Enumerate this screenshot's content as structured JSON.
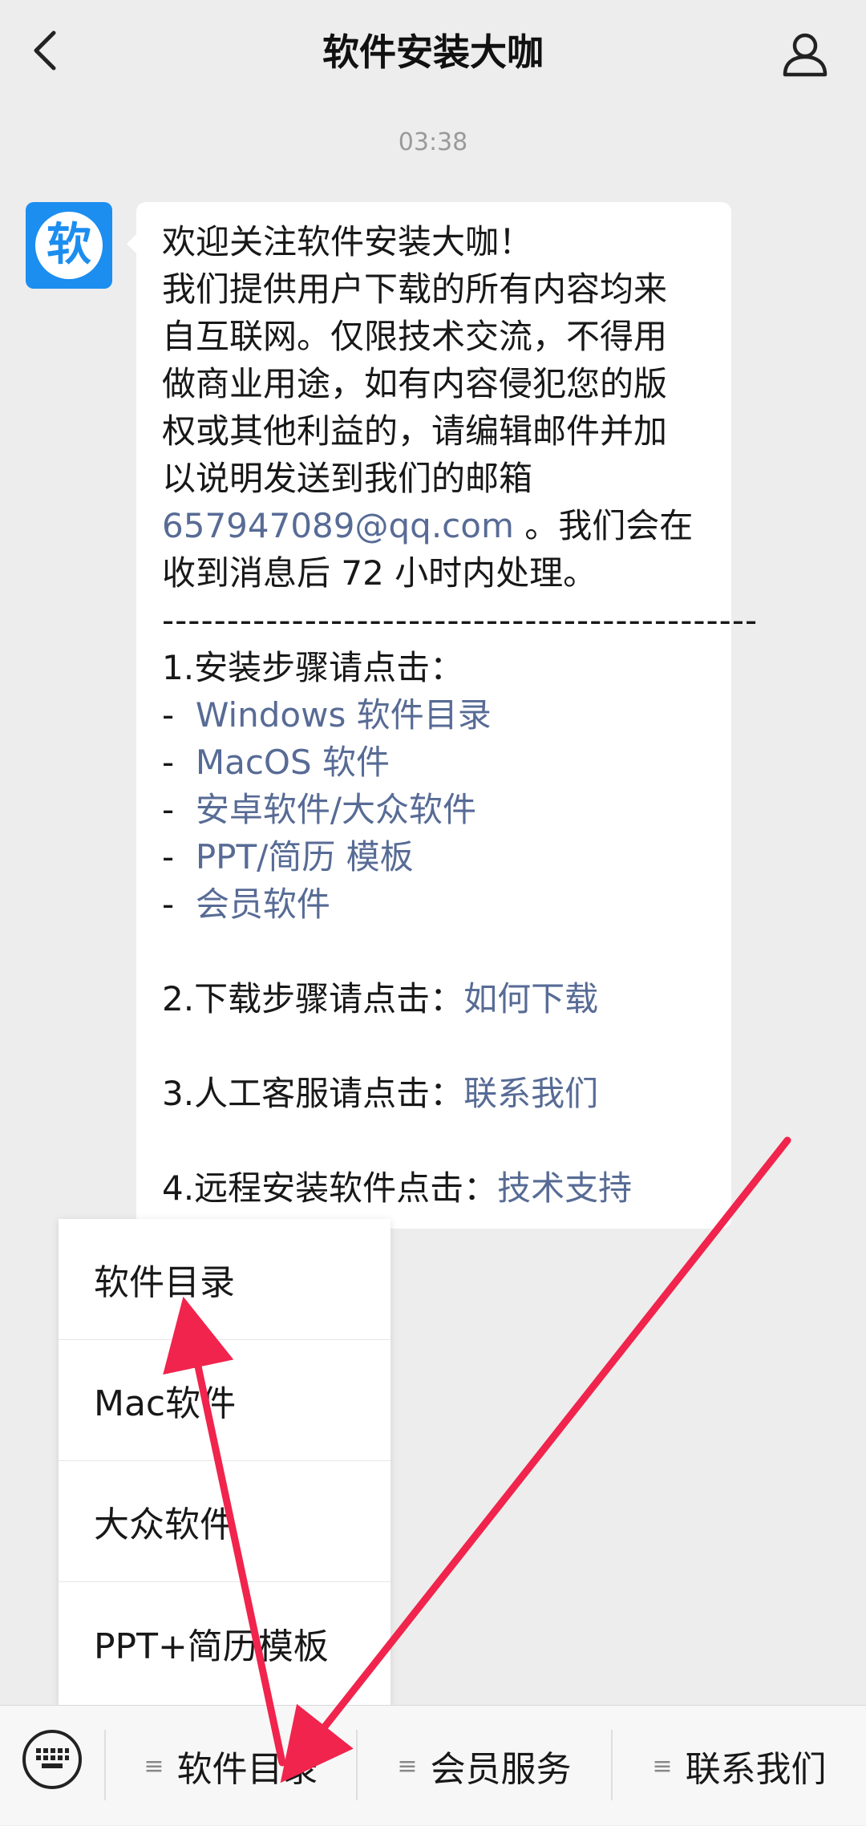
{
  "header": {
    "title": "软件安装大咖",
    "back_icon": "chevron-left-icon",
    "profile_icon": "person-icon"
  },
  "timestamp": "03:38",
  "avatar": {
    "text": "软",
    "color": "#1b8ef0"
  },
  "message": {
    "l1": "欢迎关注软件安装大咖！",
    "l2": "我们提供用户下载的所有内容均来",
    "l3": "自互联网。仅限技术交流，不得用",
    "l4": "做商业用途，如有内容侵犯您的版",
    "l5": "权或其他利益的，请编辑邮件并加",
    "l6": "以说明发送到我们的邮箱",
    "email": "657947089@qq.com",
    "l7_rest": " 。我们会在",
    "l8": "收到消息后 72 小时内处理。",
    "separator": "----------------------------------------------",
    "s1_label": "1.安装步骤请点击：",
    "dash": "-",
    "links": [
      "Windows 软件目录",
      "MacOS 软件",
      "安卓软件/大众软件",
      "PPT/简历 模板",
      "会员软件"
    ],
    "s2_label": "2.下载步骤请点击：",
    "s2_link": "如何下载",
    "s3_label": "3.人工客服请点击：",
    "s3_link": "联系我们",
    "s4_label": "4.远程安装软件点击：",
    "s4_link": "技术支持"
  },
  "popup_menu": {
    "items": [
      "软件目录",
      "Mac软件",
      "大众软件",
      "PPT+简历模板"
    ]
  },
  "bottom_menu": {
    "keyboard_icon": "keyboard-icon",
    "menu_icon": "≡",
    "items": [
      "软件目录",
      "会员服务",
      "联系我们"
    ]
  },
  "colors": {
    "link": "#576b95",
    "annotation_arrow": "#f0244d",
    "background": "#ededed"
  }
}
